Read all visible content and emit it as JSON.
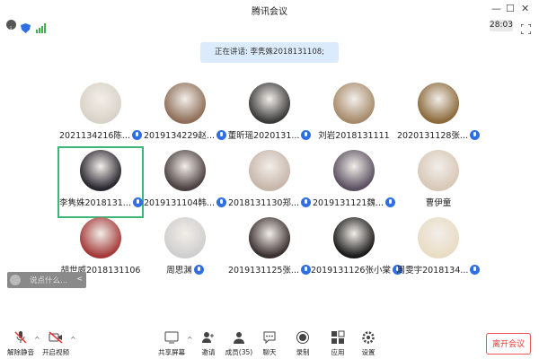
{
  "window": {
    "title": "腾讯会议",
    "minimize": "—",
    "maximize": "☐",
    "close": "✕"
  },
  "status": {
    "timer": "28:03",
    "info_icon": "info-icon",
    "shield_icon": "shield-icon",
    "signal_icon": "signal-icon"
  },
  "speaking_text": "正在讲话: 李隽姝2018131108;",
  "participants": [
    {
      "name": "2021134216陈...",
      "mic": true,
      "color": "#d9d2c8"
    },
    {
      "name": "2019134229赵...",
      "mic": true,
      "color": "#8e6e58"
    },
    {
      "name": "董昕瑶2020131...",
      "mic": true,
      "color": "#3a3a3a"
    },
    {
      "name": "刘岩2018131111",
      "mic": false,
      "color": "#a68a6a"
    },
    {
      "name": "2020131128张...",
      "mic": true,
      "color": "#8c6a3c"
    },
    {
      "name": "李隽姝2018131...",
      "mic": true,
      "color": "#2a2630",
      "selected": true
    },
    {
      "name": "2019131104韩...",
      "mic": true,
      "color": "#4b4040"
    },
    {
      "name": "2018131130郑...",
      "mic": true,
      "color": "#c7b6aa"
    },
    {
      "name": "2019131121魏...",
      "mic": true,
      "color": "#5a5060"
    },
    {
      "name": "曹伊童",
      "mic": false,
      "color": "#d8c8b8"
    },
    {
      "name": "胡世威2018131106",
      "mic": false,
      "color": "#a43a3a"
    },
    {
      "name": "周思渊",
      "mic": true,
      "color": "#cfcfcf"
    },
    {
      "name": "2019131125张...",
      "mic": true,
      "color": "#3a3030"
    },
    {
      "name": "2019131126张小棠",
      "mic": true,
      "color": "#1a1a1a"
    },
    {
      "name": "周雯宇2018134...",
      "mic": true,
      "color": "#e8dcc4"
    }
  ],
  "chat": {
    "placeholder": "说点什么...",
    "arrow": "<"
  },
  "toolbar": {
    "mute": "解除静音",
    "video": "开启视频",
    "share": "共享屏幕",
    "invite": "邀请",
    "members": "成员(35)",
    "chat": "聊天",
    "record": "录制",
    "apps": "应用",
    "settings": "设置",
    "leave": "离开会议",
    "caret": "^"
  },
  "colors": {
    "accent": "#2f6fe3",
    "selected_border": "#3cb77a",
    "leave": "#e33333",
    "speaking_bg": "#dcebfb"
  }
}
